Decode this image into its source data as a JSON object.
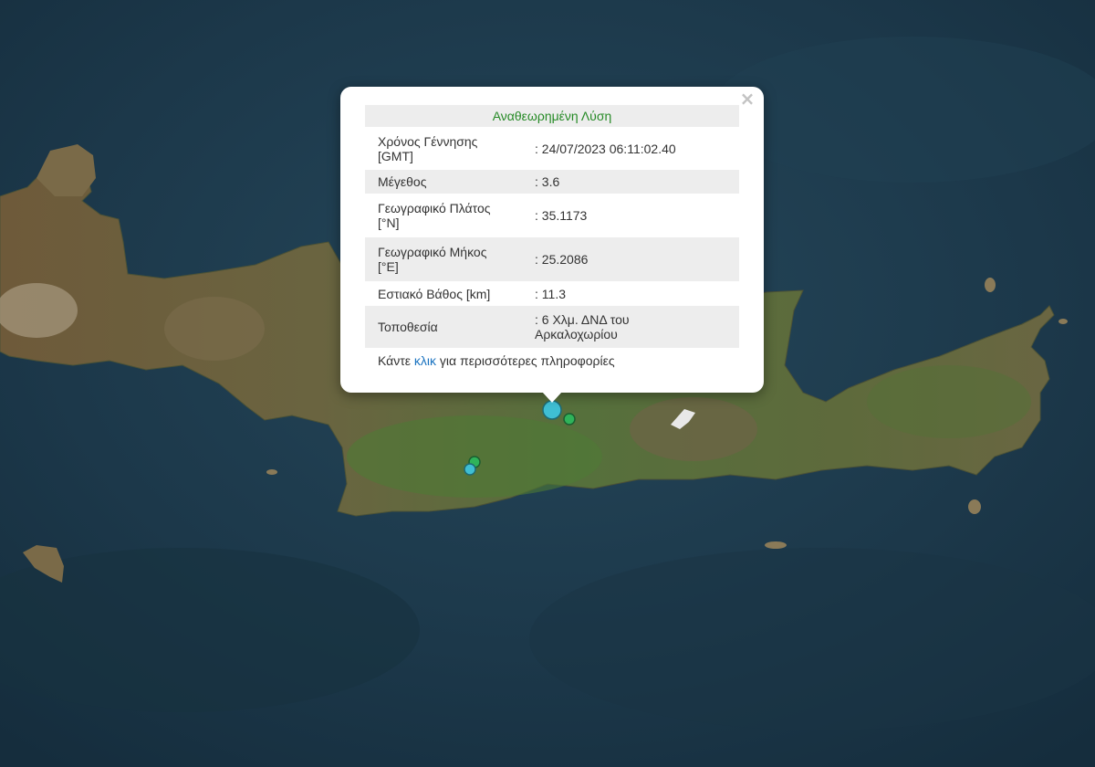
{
  "map": {
    "markers": [
      {
        "color": "#3fbfd3",
        "size": "large"
      },
      {
        "color": "#2fb35a",
        "size": "small"
      },
      {
        "color": "#2fb35a",
        "size": "small"
      },
      {
        "color": "#3fbfd3",
        "size": "small"
      }
    ]
  },
  "popup": {
    "title": "Αναθεωρημένη Λύση",
    "close_icon": "×",
    "rows": [
      {
        "label_line1": "Χρόνος Γέννησης",
        "label_line2": "[GMT]",
        "value": ": 24/07/2023 06:11:02.40"
      },
      {
        "label": "Μέγεθος",
        "value": ": 3.6"
      },
      {
        "label_line1": "Γεωγραφικό Πλάτος",
        "label_line2": "[°N]",
        "value": ": 35.1173"
      },
      {
        "label_line1": "Γεωγραφικό Μήκος",
        "label_line2": "[°E]",
        "value": ": 25.2086"
      },
      {
        "label": "Εστιακό Βάθος [km]",
        "value": ": 11.3"
      },
      {
        "label": "Τοποθεσία",
        "value_line1": ": 6 Χλμ. ΔΝΔ του",
        "value_line2": "Αρκαλοχωρίου"
      }
    ],
    "footer": {
      "prefix": "Κάντε ",
      "link": "κλικ",
      "suffix": " για περισσότερες πληροφορίες"
    }
  },
  "colors": {
    "sea": "#1d3a4c",
    "land": "#5e6a3a",
    "title_green": "#268a26",
    "link": "#1a73c0"
  }
}
